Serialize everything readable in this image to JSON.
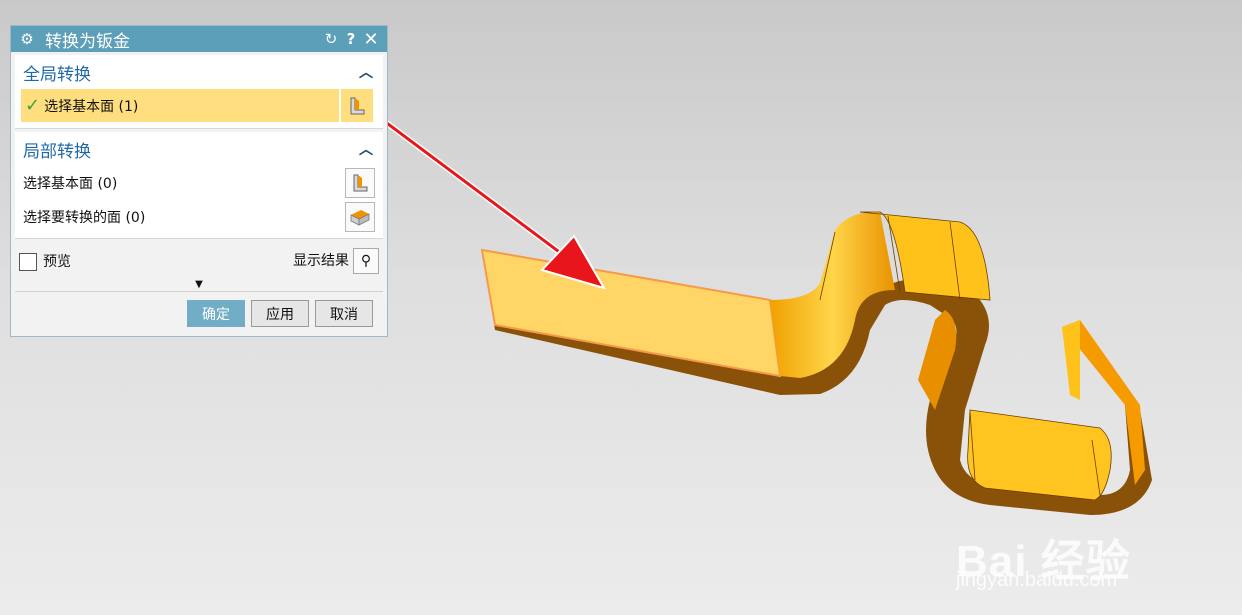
{
  "dialog": {
    "title": "转换为钣金",
    "global": {
      "header": "全局转换",
      "select_label": "选择基本面 (1)"
    },
    "local": {
      "header": "局部转换",
      "select_base": "选择基本面 (0)",
      "select_faces": "选择要转换的面 (0)"
    },
    "preview_label": "预览",
    "show_result_label": "显示结果",
    "buttons": {
      "ok": "确定",
      "apply": "应用",
      "cancel": "取消"
    }
  },
  "icons": [
    "gear-icon",
    "reset-icon",
    "help-icon",
    "close-icon",
    "chevron-up-icon",
    "check-icon",
    "face-select-icon",
    "convert-face-icon",
    "magnifier-icon",
    "more-arrow-icon"
  ],
  "colors": {
    "title_bar": "#5b9fb8",
    "selection": "#ffde80",
    "part": "#f7b500",
    "arrow": "#e8161b"
  },
  "watermark": {
    "brand": "Bai 经验",
    "url": "jingyan.baidu.com"
  }
}
